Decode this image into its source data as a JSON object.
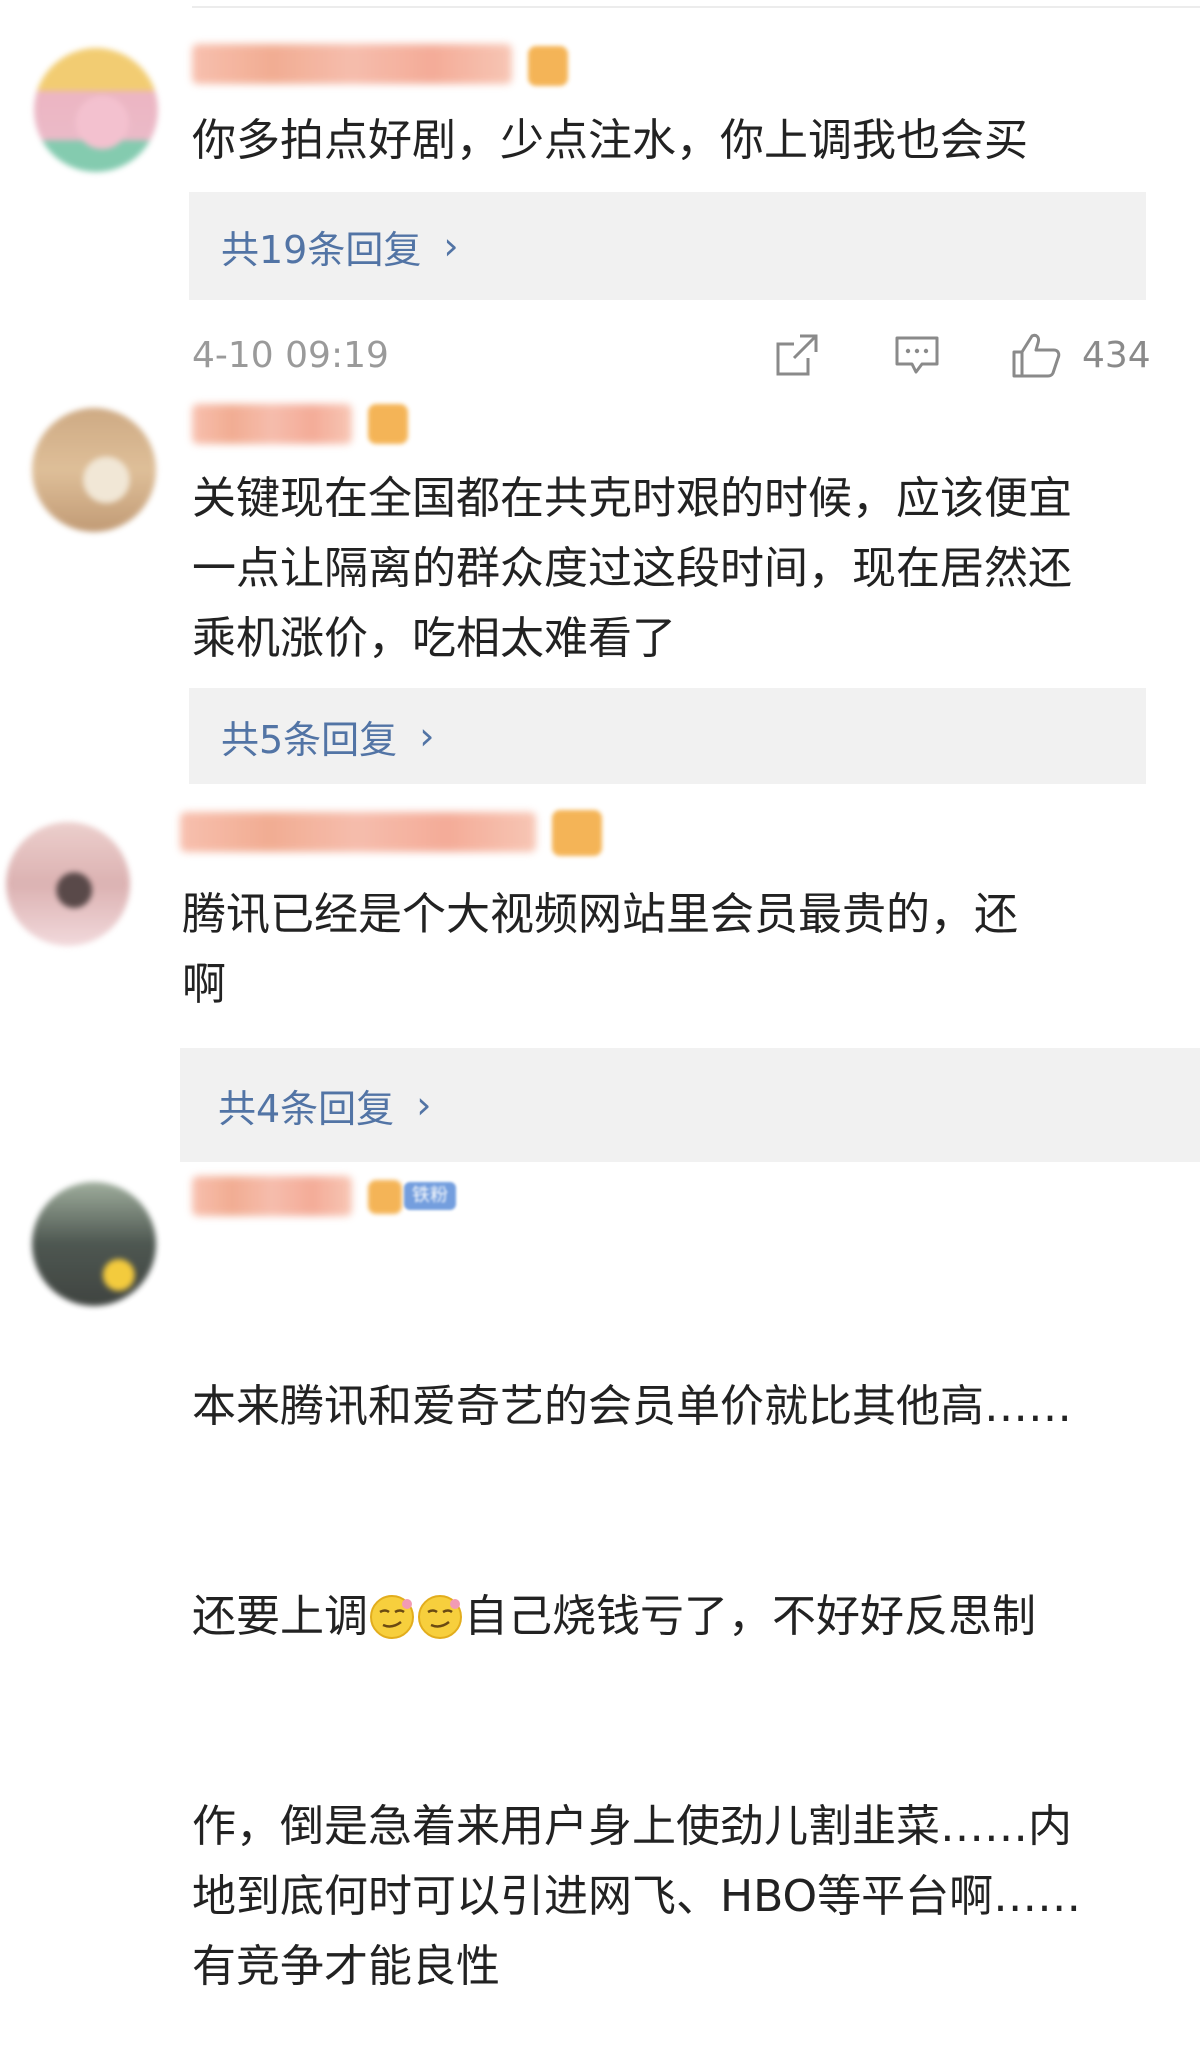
{
  "comments": [
    {
      "text": "你多拍点好剧，少点注水，你上调我也会买",
      "replies": "共19条回复",
      "time": "4-10 09:19",
      "likes": "434"
    },
    {
      "text": "关键现在全国都在共克时艰的时候，应该便宜\n一点让隔离的群众度过这段时间，现在居然还\n乘机涨价，吃相太难看了",
      "replies": "共5条回复"
    },
    {
      "text": "腾讯已经是个大视频网站里会员最贵的，还\n啊",
      "replies": "共4条回复"
    },
    {
      "text_line1": "本来腾讯和爱奇艺的会员单价就比其他高……",
      "text_line2_a": "还要上调",
      "text_line2_b": "自己烧钱亏了，不好好反思制",
      "text_rest": "作，倒是急着来用户身上使劲儿割韭菜……内\n地到底何时可以引进网飞、HBO等平台啊……\n有竞争才能良性",
      "badge": "铁粉"
    }
  ],
  "icons": [
    "share-icon",
    "comment-icon",
    "like-icon",
    "smirk-emoji-icon"
  ],
  "colors": {
    "reply_link": "#5274a5",
    "reply_bg": "#f1f1f1",
    "meta_gray": "#9a9a9a"
  }
}
